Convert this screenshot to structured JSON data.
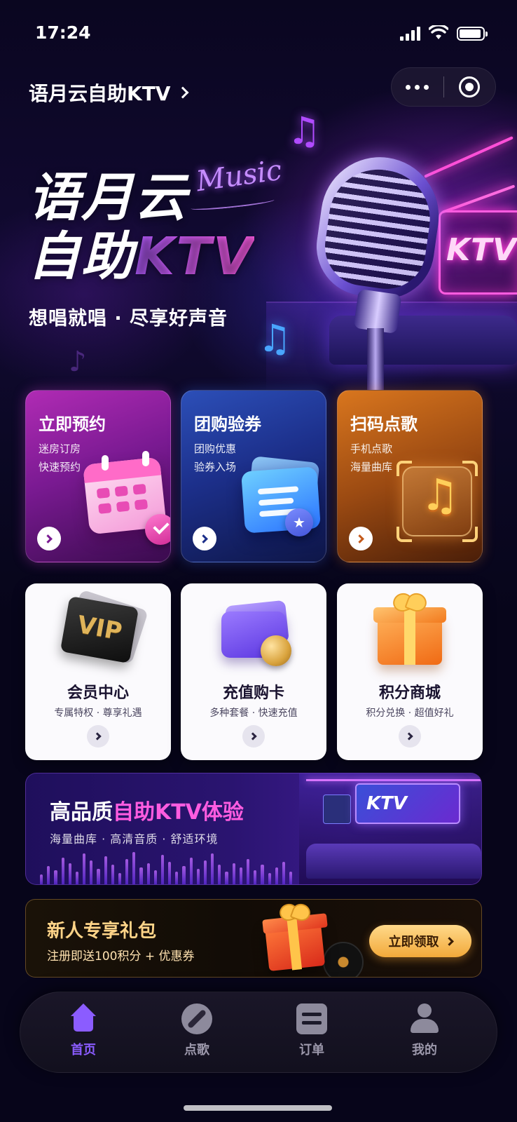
{
  "status_bar": {
    "time": "17:24"
  },
  "header": {
    "app_title": "语月云自助KTV"
  },
  "hero": {
    "title_line1": "语月云",
    "title_line2_prefix": "自助",
    "title_line2_highlight": "KTV",
    "script_word": "Music",
    "subtitle": "想唱就唱 · 尽享好声音",
    "neon_sign": "KTV"
  },
  "feature_cards": [
    {
      "title": "立即预约",
      "desc_line1": "迷房订房",
      "desc_line2": "快速预约",
      "icon": "calendar-icon"
    },
    {
      "title": "团购验券",
      "desc_line1": "团购优惠",
      "desc_line2": "验券入场",
      "icon": "ticket-icon"
    },
    {
      "title": "扫码点歌",
      "desc_line1": "手机点歌",
      "desc_line2": "海量曲库",
      "icon": "music-note-icon"
    }
  ],
  "service_cards": [
    {
      "title": "会员中心",
      "desc": "专属特权 · 尊享礼遇",
      "icon": "vip-card-icon",
      "badge_text": "VIP"
    },
    {
      "title": "充值购卡",
      "desc": "多种套餐 · 快速充值",
      "icon": "wallet-icon"
    },
    {
      "title": "积分商城",
      "desc": "积分兑换 · 超值好礼",
      "icon": "gift-icon"
    }
  ],
  "experience_banner": {
    "title_prefix": "高品质",
    "title_highlight": "自助KTV体验",
    "subtitle": "海量曲库 · 高清音质 · 舒适环境",
    "screen_text": "KTV"
  },
  "gift_banner": {
    "title": "新人专享礼包",
    "subtitle": "注册即送100积分 + 优惠券",
    "button_label": "立即领取"
  },
  "tab_bar": {
    "active": "首页",
    "tabs": [
      {
        "label": "首页",
        "icon": "home-icon"
      },
      {
        "label": "点歌",
        "icon": "compass-icon"
      },
      {
        "label": "订单",
        "icon": "orders-icon"
      },
      {
        "label": "我的",
        "icon": "user-icon"
      }
    ]
  },
  "colors": {
    "accent_purple": "#8b5cff",
    "neon_pink": "#ff5ce0",
    "gold": "#ffd488",
    "background": "#07051a"
  }
}
